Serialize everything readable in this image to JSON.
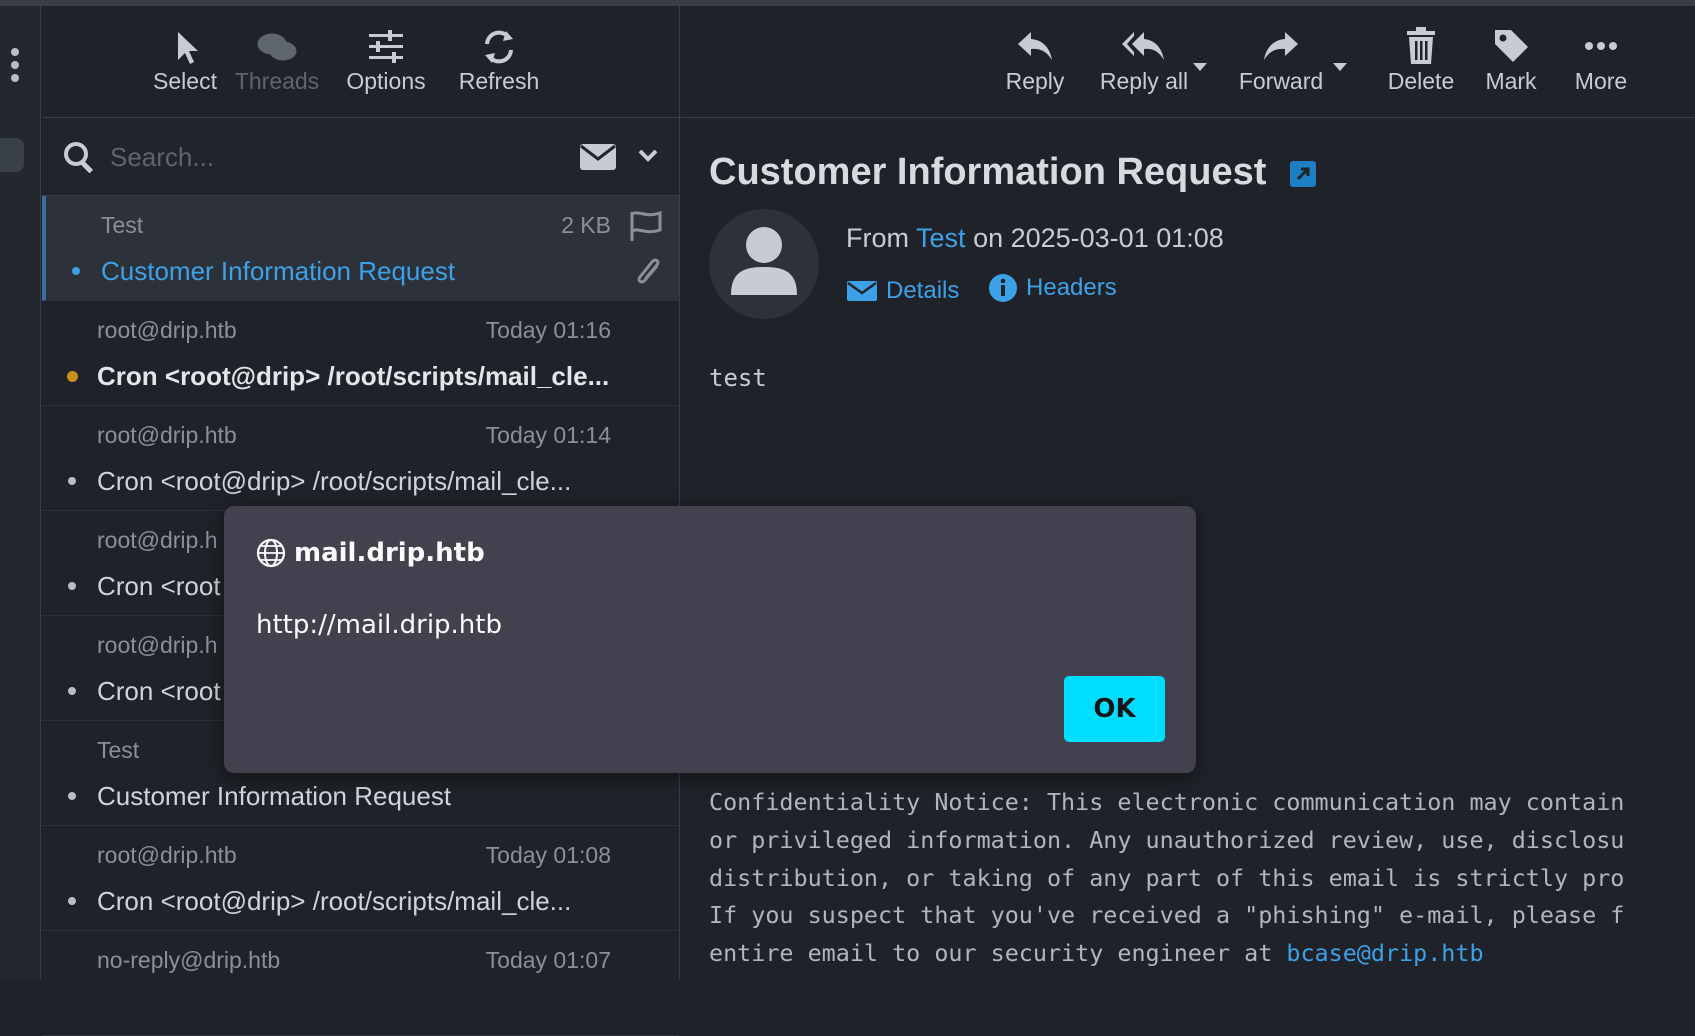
{
  "list_toolbar": {
    "select": "Select",
    "threads": "Threads",
    "options": "Options",
    "refresh": "Refresh"
  },
  "read_toolbar": {
    "reply": "Reply",
    "reply_all": "Reply all",
    "forward": "Forward",
    "delete": "Delete",
    "mark": "Mark",
    "more": "More"
  },
  "search": {
    "placeholder": "Search..."
  },
  "messages": [
    {
      "from": "Test",
      "meta": "2 KB",
      "subject": "Customer Information Request",
      "selected": true
    },
    {
      "from": "root@drip.htb",
      "meta": "Today 01:16",
      "subject": "Cron <root@drip> /root/scripts/mail_cle...",
      "unread": true
    },
    {
      "from": "root@drip.htb",
      "meta": "Today 01:14",
      "subject": "Cron <root@drip> /root/scripts/mail_cle..."
    },
    {
      "from": "root@drip.h",
      "meta": "",
      "subject": "Cron <root"
    },
    {
      "from": "root@drip.h",
      "meta": "",
      "subject": "Cron <root"
    },
    {
      "from": "Test",
      "meta": "",
      "subject": "Customer Information Request"
    },
    {
      "from": "root@drip.htb",
      "meta": "Today 01:08",
      "subject": "Cron <root@drip> /root/scripts/mail_cle..."
    },
    {
      "from": "no-reply@drip.htb",
      "meta": "Today 01:07",
      "subject": ""
    }
  ],
  "email": {
    "subject": "Customer Information Request",
    "from_prefix": "From",
    "from_name": "Test",
    "date_text": "on 2025-03-01 01:08",
    "details": "Details",
    "headers": "Headers",
    "body": "test",
    "notice_lines": [
      "Confidentiality Notice: This electronic communication may contain",
      "or privileged information. Any unauthorized review, use, disclosu",
      "distribution, or taking of any part of this email is strictly pro",
      "If you suspect that you've received a \"phishing\" e-mail, please f"
    ],
    "notice_last_prefix": "entire email to our security engineer at ",
    "notice_email": "bcase@drip.htb"
  },
  "dialog": {
    "title": "mail.drip.htb",
    "message": "http://mail.drip.htb",
    "ok": "OK"
  },
  "colors": {
    "accent": "#3da1e8",
    "unread_dot": "#c79018",
    "ok_button": "#00ddff",
    "dialog_bg": "#42414d"
  }
}
